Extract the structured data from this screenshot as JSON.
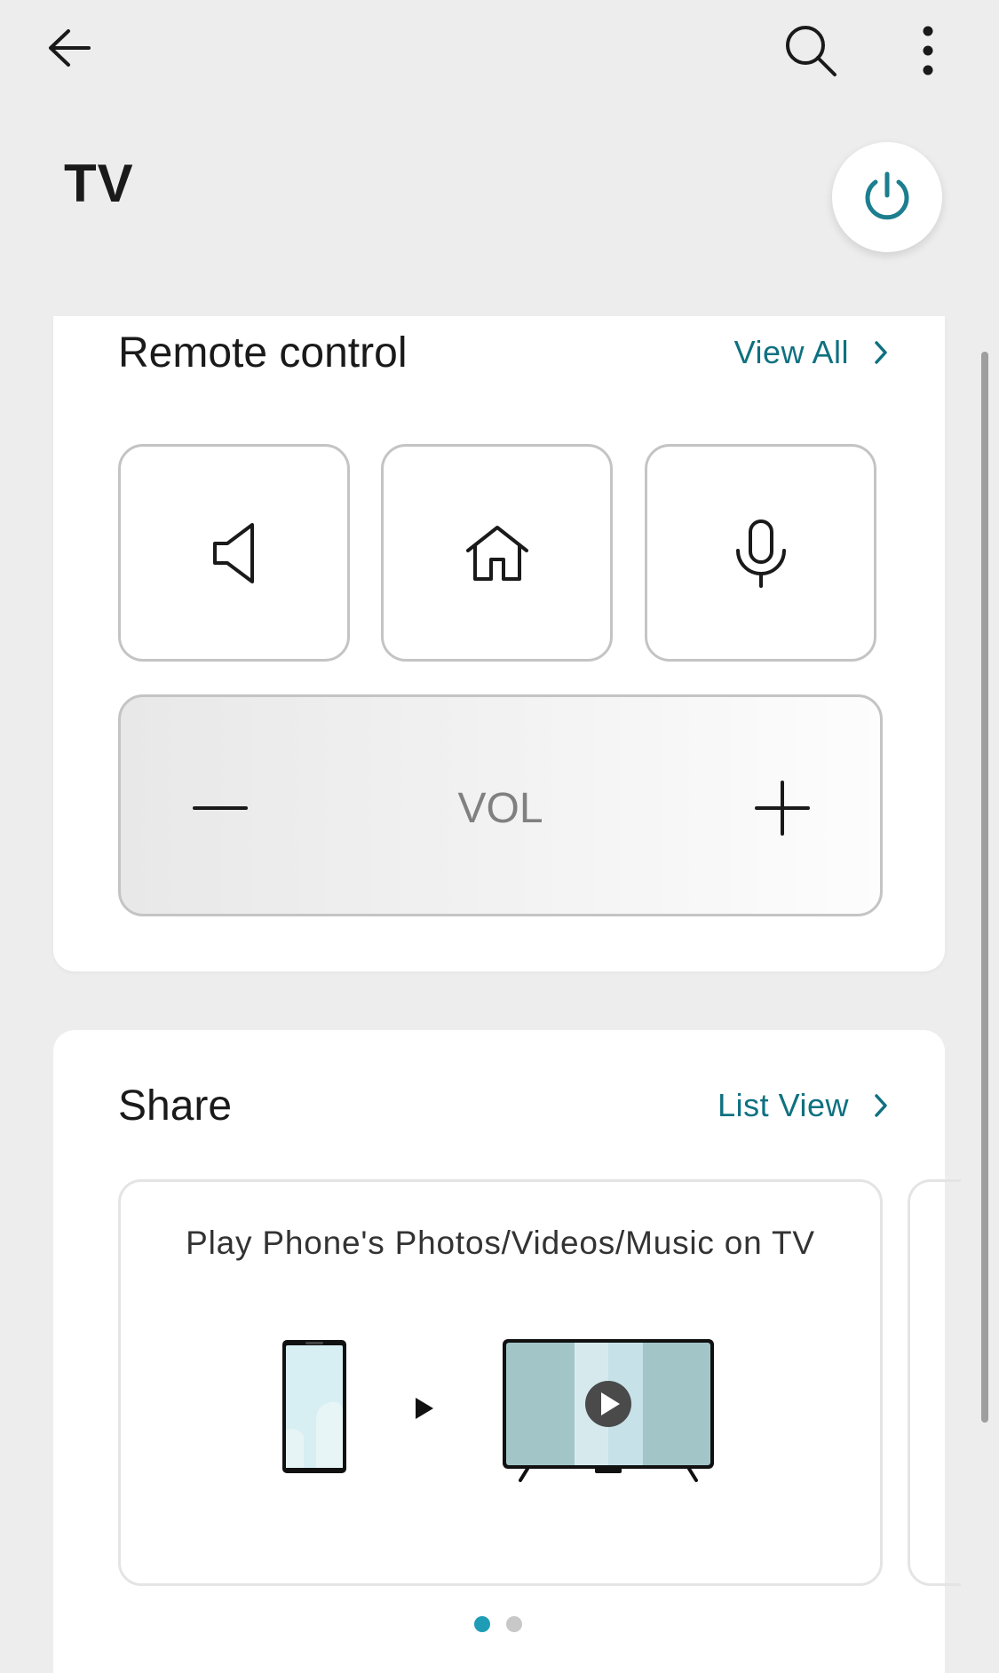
{
  "header": {
    "back_icon": "arrow-left-icon",
    "search_icon": "search-icon",
    "more_icon": "more-vertical-icon"
  },
  "page": {
    "title": "TV",
    "power_icon": "power-icon",
    "accent_color": "#1c7e8e"
  },
  "remote": {
    "title": "Remote control",
    "view_all": "View All",
    "buttons": [
      {
        "icon": "mute-speaker-icon"
      },
      {
        "icon": "home-icon"
      },
      {
        "icon": "microphone-icon"
      }
    ],
    "volume": {
      "label": "VOL",
      "minus_icon": "minus-icon",
      "plus_icon": "plus-icon"
    }
  },
  "share": {
    "title": "Share",
    "list_view": "List View",
    "items": [
      {
        "title": "Play Phone's Photos/Videos/Music on TV",
        "illustration": "phone-to-tv-illustration"
      }
    ],
    "page_indicator": {
      "count": 2,
      "active": 1
    }
  }
}
